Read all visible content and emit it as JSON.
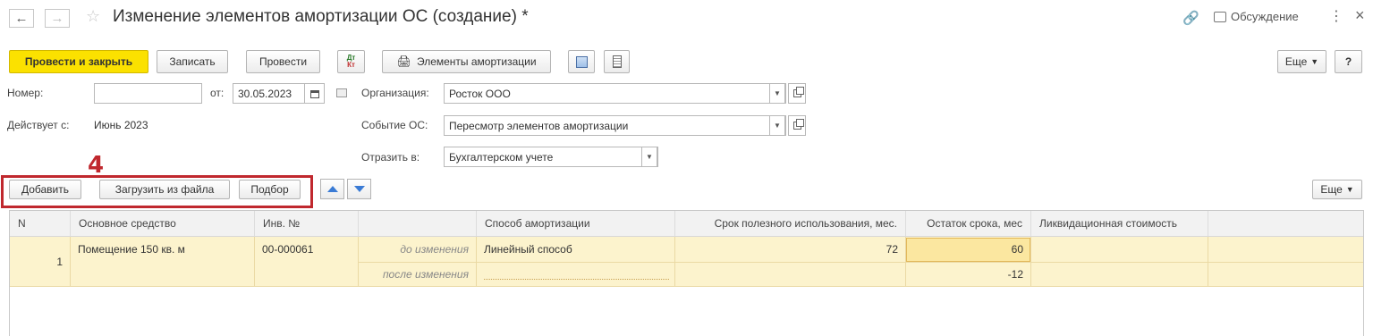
{
  "window": {
    "title": "Изменение элементов амортизации ОС (создание) *",
    "discussion_label": "Обсуждение"
  },
  "toolbar": {
    "post_close": "Провести и закрыть",
    "save": "Записать",
    "post": "Провести",
    "dt": "Дт",
    "kt": "Кт",
    "elements": "Элементы амортизации",
    "more": "Еще"
  },
  "form": {
    "number_label": "Номер:",
    "number_value": "",
    "from_label": "от:",
    "date_value": "30.05.2023",
    "org_label": "Организация:",
    "org_value": "Росток ООО",
    "effective_label": "Действует с:",
    "effective_value": "Июнь 2023",
    "event_label": "Событие ОС:",
    "event_value": "Пересмотр элементов амортизации",
    "reflect_label": "Отразить в:",
    "reflect_value": "Бухгалтерском учете"
  },
  "annotation": {
    "number": "4"
  },
  "table_toolbar": {
    "add": "Добавить",
    "load": "Загрузить из файла",
    "pick": "Подбор",
    "more": "Еще"
  },
  "table": {
    "columns": [
      "N",
      "Основное средство",
      "Инв. №",
      "",
      "Способ амортизации",
      "Срок полезного использования, мес.",
      "Остаток срока, мес",
      "Ликвидационная стоимость"
    ],
    "rows": [
      {
        "n": "1",
        "asset": "Помещение 150 кв. м",
        "inv": "00-000061",
        "before_label": "до изменения",
        "method": "Линейный способ",
        "term": "72",
        "remaining": "60",
        "liquidation": "",
        "after_label": "после изменения",
        "after_method": "",
        "after_term": "",
        "after_remaining": "-12",
        "after_liquidation": ""
      }
    ]
  },
  "colors": {
    "primary_button": "#fbe100",
    "row_highlight": "#fcf3cd",
    "annotation_red": "#c0282e",
    "arrow_blue": "#3a7bd5"
  }
}
